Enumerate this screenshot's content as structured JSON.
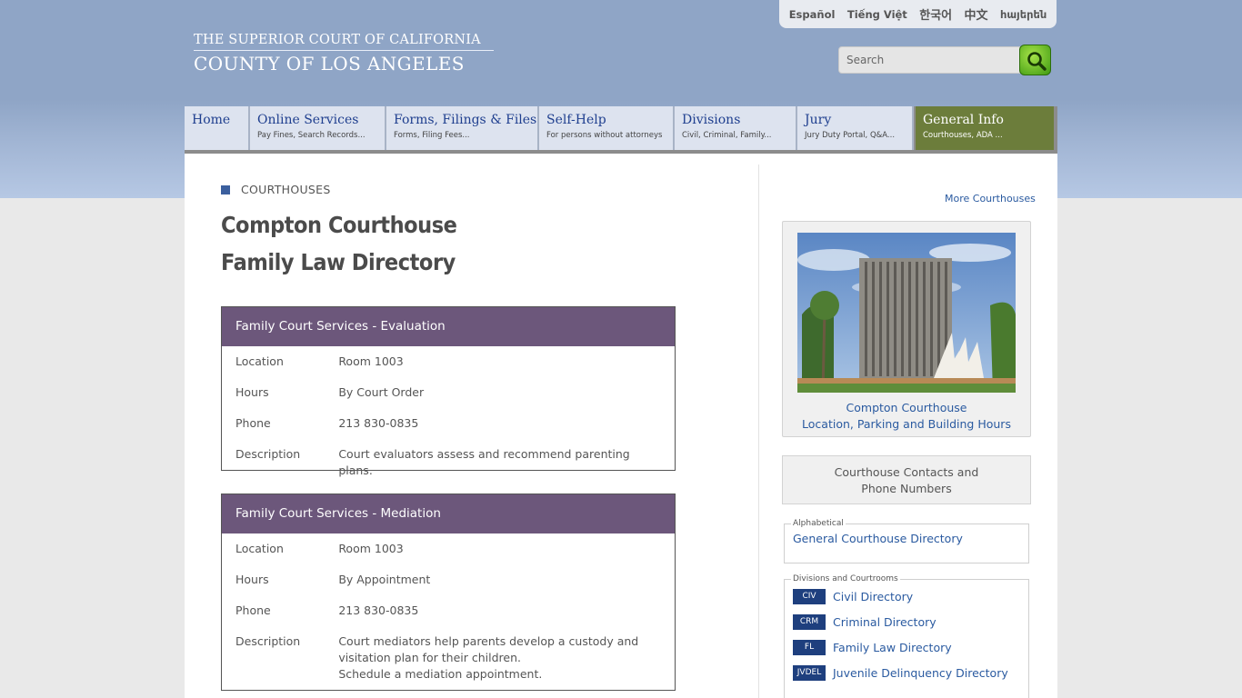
{
  "logo": {
    "line1": "THE SUPERIOR COURT OF CALIFORNIA",
    "line2": "COUNTY OF LOS ANGELES"
  },
  "languages": [
    "Español",
    "Tiếng Việt",
    "한국어",
    "中文",
    "հայերեն"
  ],
  "search": {
    "placeholder": "Search",
    "icon": "magnifier-icon"
  },
  "nav": [
    {
      "title": "Home",
      "sub": ""
    },
    {
      "title": "Online Services",
      "sub": "Pay Fines, Search Records..."
    },
    {
      "title": "Forms, Filings & Files",
      "sub": "Forms, Filing Fees..."
    },
    {
      "title": "Self-Help",
      "sub": "For persons without attorneys"
    },
    {
      "title": "Divisions",
      "sub": "Civil, Criminal, Family..."
    },
    {
      "title": "Jury",
      "sub": "Jury Duty Portal, Q&A..."
    },
    {
      "title": "General Info",
      "sub": "Courthouses, ADA ..."
    }
  ],
  "breadcrumb": "COURTHOUSES",
  "page": {
    "title_line1": "Compton Courthouse",
    "title_line2": "Family Law Directory"
  },
  "cards": [
    {
      "heading": "Family Court Services - Evaluation",
      "location_label": "Location",
      "location": "Room 1003",
      "hours_label": "Hours",
      "hours": "By Court Order",
      "phone_label": "Phone",
      "phone": "213 830-0835",
      "description_label": "Description",
      "description": "Court evaluators assess and recommend parenting plans."
    },
    {
      "heading": "Family Court Services - Mediation",
      "location_label": "Location",
      "location": "Room 1003",
      "hours_label": "Hours",
      "hours": "By Appointment",
      "phone_label": "Phone",
      "phone": "213 830-0835",
      "description_label": "Description",
      "description": "Court mediators help parents develop a custody and visitation plan for their children.",
      "description_extra": "Schedule a mediation appointment."
    }
  ],
  "sidebar": {
    "more_courthouses": "More Courthouses",
    "photo_caption_line1": "Compton Courthouse",
    "photo_caption_line2": "Location, Parking and Building Hours",
    "contacts_line1": "Courthouse Contacts and",
    "contacts_line2": "Phone Numbers",
    "alphabetical_legend": "Alphabetical",
    "general_directory": "General Courthouse Directory",
    "divisions_legend": "Divisions and Courtrooms",
    "directories": [
      {
        "badge": "CIV",
        "label": "Civil Directory"
      },
      {
        "badge": "CRM",
        "label": "Criminal Directory"
      },
      {
        "badge": "FL",
        "label": "Family Law Directory"
      },
      {
        "badge": "JVDEL",
        "label": "Juvenile Delinquency Directory"
      }
    ]
  },
  "colors": {
    "header_blue": "#8fa5c6",
    "nav_active": "#6c7d3b",
    "card_header": "#6c577b",
    "link": "#2a5aa0",
    "badge": "#1e3f7e"
  }
}
